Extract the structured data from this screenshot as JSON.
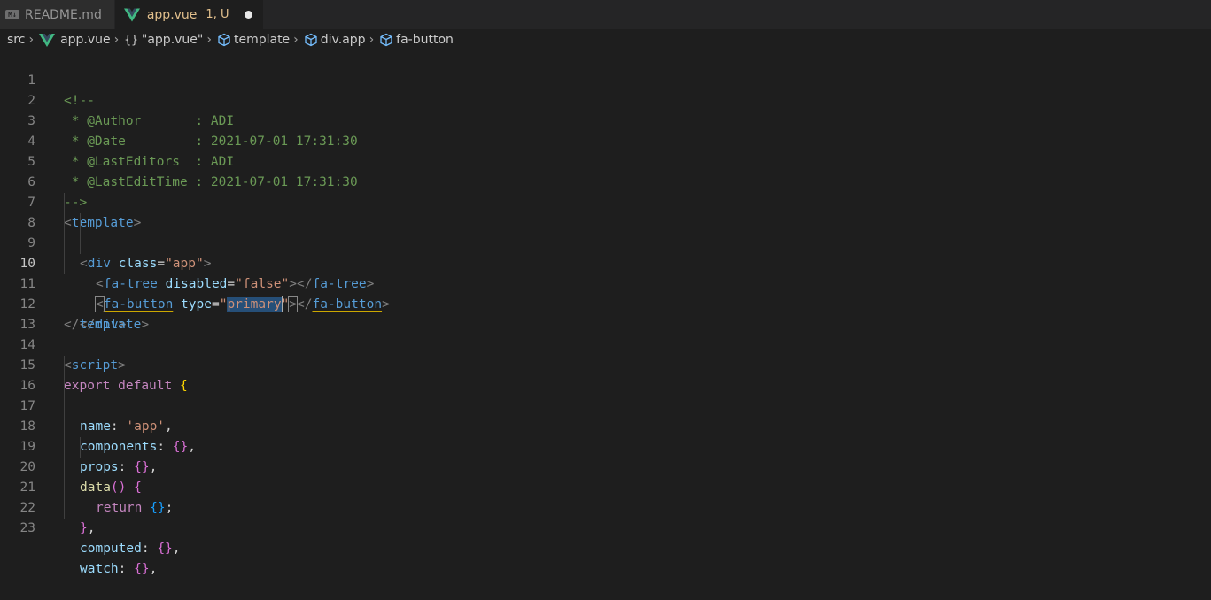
{
  "tabs": [
    {
      "name": "README.md",
      "icon": "markdown-icon",
      "icon_text": "M↓",
      "active": false,
      "status": ""
    },
    {
      "name": "app.vue",
      "icon": "vue-icon",
      "active": true,
      "status": "1, U"
    }
  ],
  "breadcrumb": {
    "items": [
      {
        "label": "src",
        "icon": ""
      },
      {
        "label": "app.vue",
        "icon": "vue-icon"
      },
      {
        "label": "\"app.vue\"",
        "icon": "braces-icon",
        "icon_text": "{}"
      },
      {
        "label": "template",
        "icon": "cube-icon"
      },
      {
        "label": "div.app",
        "icon": "cube-icon"
      },
      {
        "label": "fa-button",
        "icon": "cube-icon"
      }
    ]
  },
  "editor": {
    "current_line": 10,
    "line_numbers": [
      "1",
      "2",
      "3",
      "4",
      "5",
      "6",
      "7",
      "8",
      "9",
      "10",
      "11",
      "12",
      "13",
      "14",
      "15",
      "16",
      "17",
      "18",
      "19",
      "20",
      "21",
      "22",
      "23"
    ],
    "tokens": {
      "l1": "<!--",
      "l2": " * @Author       : ADI",
      "l3": " * @Date         : 2021-07-01 17:31:30",
      "l4": " * @LastEditors  : ADI",
      "l5": " * @LastEditTime : 2021-07-01 17:31:30",
      "l6": "-->",
      "lt": "<",
      "gt": ">",
      "ltslash": "</",
      "template": "template",
      "div": "div",
      "class": "class",
      "eq": "=",
      "app_str": "\"app\"",
      "fa_tree": "fa-tree",
      "disabled": "disabled",
      "false_str": "\"false\"",
      "fa_button": "fa-button",
      "type": "type",
      "quote": "\"",
      "primary": "primary",
      "script": "script",
      "export": "export",
      "default": "default",
      "ob": "{",
      "cb": "}",
      "name": "name",
      "colon": ":",
      "app_sq": "'app'",
      "comma": ",",
      "components": "components",
      "props": "props",
      "data": "data",
      "parens": "()",
      "return": "return",
      "semi": ";",
      "computed": "computed",
      "watch": "watch"
    }
  },
  "colors": {
    "background": "#1e1e1e",
    "tab_modified": "#e2c08d",
    "comment": "#6a9955",
    "tag": "#569cd6",
    "attribute": "#9cdcfe",
    "string": "#ce9178",
    "keyword": "#c586c0",
    "selection": "#264f78"
  }
}
